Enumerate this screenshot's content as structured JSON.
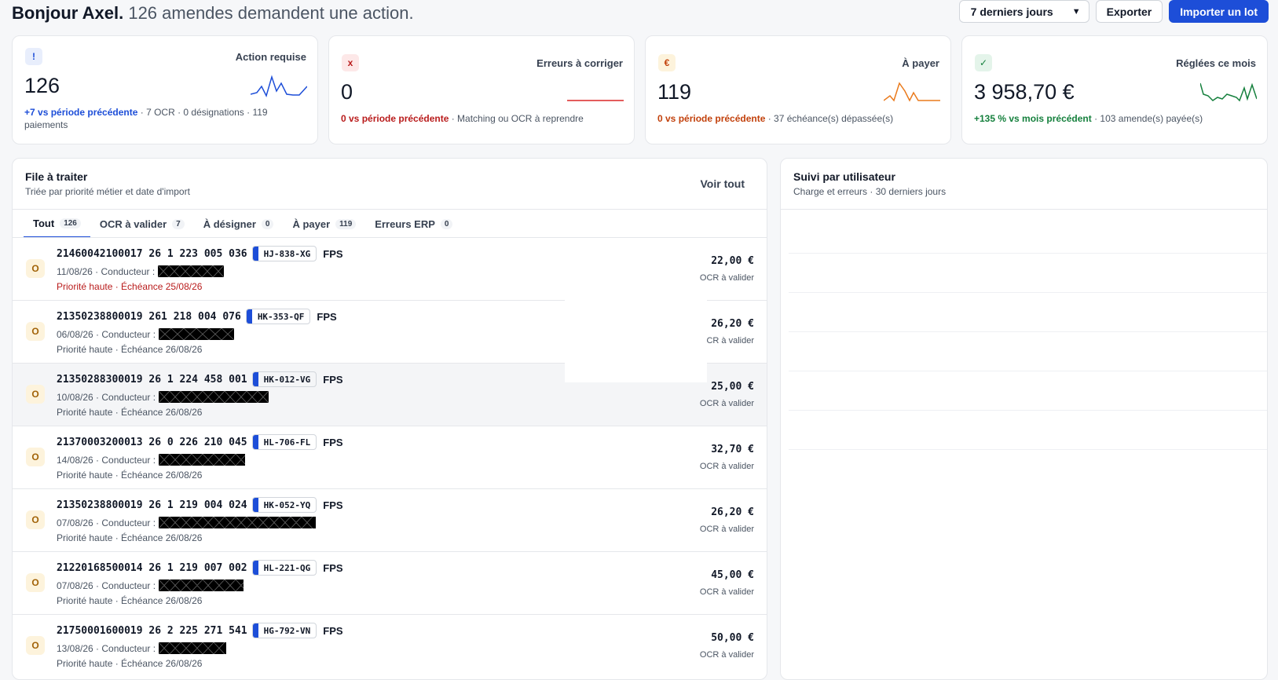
{
  "header": {
    "greeting_name": "Bonjour Axel.",
    "greeting_sub": "126 amendes demandent une action.",
    "period_select": "7 derniers jours",
    "export_label": "Exporter",
    "import_label": "Importer un lot"
  },
  "kpis": [
    {
      "badge": "!",
      "title": "Action requise",
      "value": "126",
      "delta": "+7 vs période précédente",
      "detail": " · 7 OCR · 0 désignations · 119 paiements",
      "color": "#1d4ed8"
    },
    {
      "badge": "x",
      "title": "Erreurs à corriger",
      "value": "0",
      "delta": "0 vs période précédente",
      "detail": " · Matching ou OCR à reprendre",
      "color": "#b91c1c"
    },
    {
      "badge": "€",
      "title": "À payer",
      "value": "119",
      "delta": "0 vs période précédente",
      "detail": " · 37 échéance(s) dépassée(s)",
      "color": "#c2410c"
    },
    {
      "badge": "✓",
      "title": "Réglées ce mois",
      "value": "3 958,70 €",
      "delta": "+135 % vs mois précédent",
      "detail": " · 103 amende(s) payée(s)",
      "color": "#15803d"
    }
  ],
  "queue": {
    "title": "File à traiter",
    "subtitle": "Triée par priorité métier et date d'import",
    "view_all": "Voir tout",
    "tabs": [
      {
        "label": "Tout",
        "count": "126"
      },
      {
        "label": "OCR à valider",
        "count": "7"
      },
      {
        "label": "À désigner",
        "count": "0"
      },
      {
        "label": "À payer",
        "count": "119"
      },
      {
        "label": "Erreurs ERP",
        "count": "0"
      }
    ],
    "rows": [
      {
        "avatar": "O",
        "ref": "21460042100017 26 1 223 005 036",
        "plate": "HJ-838-XG",
        "type": "FPS",
        "date_driver": "11/08/26 · Conducteur :",
        "priority": "Priorité haute · Échéance 25/08/26",
        "amount": "22,00 €",
        "status": "OCR à valider"
      },
      {
        "avatar": "O",
        "ref": "21350238800019 261 218 004 076",
        "plate": "HK-353-QF",
        "type": "FPS",
        "date_driver": "06/08/26 · Conducteur :",
        "priority": "Priorité haute · Échéance 26/08/26",
        "amount": "26,20 €",
        "status": "OCR à valider"
      },
      {
        "avatar": "O",
        "ref": "21350288300019 26 1 224 458 001",
        "plate": "HK-012-VG",
        "type": "FPS",
        "date_driver": "10/08/26 · Conducteur :",
        "priority": "Priorité haute · Échéance 26/08/26",
        "amount": "25,00 €",
        "status": "OCR à valider"
      },
      {
        "avatar": "O",
        "ref": "21370003200013 26 0 226 210 045",
        "plate": "HL-706-FL",
        "type": "FPS",
        "date_driver": "14/08/26 · Conducteur :",
        "priority": "Priorité haute · Échéance 26/08/26",
        "amount": "32,70 €",
        "status": "OCR à valider"
      },
      {
        "avatar": "O",
        "ref": "21350238800019 26 1 219 004 024",
        "plate": "HK-052-YQ",
        "type": "FPS",
        "date_driver": "07/08/26 · Conducteur :",
        "priority": "Priorité haute · Échéance 26/08/26",
        "amount": "26,20 €",
        "status": "OCR à valider"
      },
      {
        "avatar": "O",
        "ref": "21220168500014 26 1 219 007 002",
        "plate": "HL-221-QG",
        "type": "FPS",
        "date_driver": "07/08/26 · Conducteur :",
        "priority": "Priorité haute · Échéance 26/08/26",
        "amount": "45,00 €",
        "status": "OCR à valider"
      },
      {
        "avatar": "O",
        "ref": "21750001600019 26 2 225 271 541",
        "plate": "HG-792-VN",
        "type": "FPS",
        "date_driver": "13/08/26 · Conducteur :",
        "priority": "Priorité haute · Échéance 26/08/26",
        "amount": "50,00 €",
        "status": "OCR à valider"
      }
    ]
  },
  "user_panel": {
    "title": "Suivi par utilisateur",
    "subtitle": "Charge et erreurs · 30 derniers jours"
  }
}
